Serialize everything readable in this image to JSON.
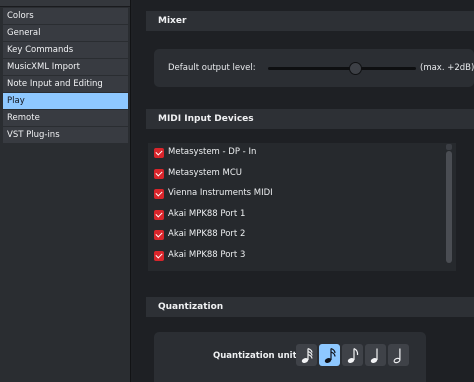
{
  "sidebar": {
    "items": [
      {
        "label": "Colors"
      },
      {
        "label": "General"
      },
      {
        "label": "Key Commands"
      },
      {
        "label": "MusicXML Import"
      },
      {
        "label": "Note Input and Editing"
      },
      {
        "label": "Play",
        "active": true
      },
      {
        "label": "Remote"
      },
      {
        "label": "VST Plug-ins"
      }
    ]
  },
  "mixer": {
    "heading": "Mixer",
    "output_level_label": "Default output level:",
    "output_level_value_label": "(max. +2dB)",
    "slider_fraction": 0.59
  },
  "midi": {
    "heading": "MIDI Input Devices",
    "devices": [
      {
        "name": "Metasystem - DP - In",
        "checked": true
      },
      {
        "name": "Metasystem MCU",
        "checked": true
      },
      {
        "name": "Vienna Instruments MIDI",
        "checked": true
      },
      {
        "name": "Akai MPK88 Port 1",
        "checked": true
      },
      {
        "name": "Akai MPK88 Port 2",
        "checked": true
      },
      {
        "name": "Akai MPK88 Port 3",
        "checked": true
      }
    ]
  },
  "quantization": {
    "heading": "Quantization",
    "unit_label": "Quantization unit:",
    "units": [
      {
        "icon": "thirty-second-note-icon",
        "selected": false
      },
      {
        "icon": "sixteenth-note-icon",
        "selected": true
      },
      {
        "icon": "eighth-note-icon",
        "selected": false
      },
      {
        "icon": "quarter-note-icon",
        "selected": false
      },
      {
        "icon": "half-note-icon",
        "selected": false
      }
    ]
  },
  "colors": {
    "accent": "#8ec8ff",
    "checkbox": "#d9252b"
  }
}
